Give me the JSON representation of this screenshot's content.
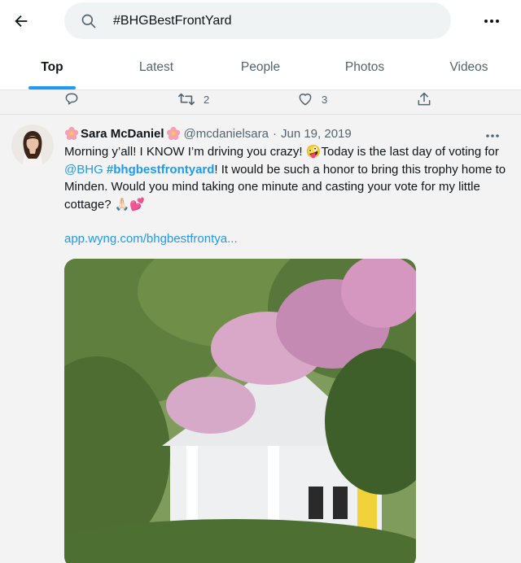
{
  "header": {
    "search_value": "#BHGBestFrontYard"
  },
  "tabs": [
    {
      "label": "Top",
      "active": true
    },
    {
      "label": "Latest",
      "active": false
    },
    {
      "label": "People",
      "active": false
    },
    {
      "label": "Photos",
      "active": false
    },
    {
      "label": "Videos",
      "active": false
    }
  ],
  "previous_tweet": {
    "reply_icon": "reply-icon",
    "retweet_icon": "retweet-icon",
    "retweet_count": "2",
    "like_icon": "heart-icon",
    "like_count": "3",
    "share_icon": "share-icon"
  },
  "tweet": {
    "name": "Sara McDaniel",
    "name_emoji": "flower-emoji",
    "handle": "@mcdanielsara",
    "separator": "·",
    "date": "Jun 19, 2019",
    "text_part1": "Morning y’all! I KNOW I’m driving you crazy! ",
    "emoji_wink": "🤪",
    "text_part2": "Today is the last day of voting for ",
    "mention": "@BHG",
    "text_part3": " ",
    "hashtag": "#bhgbestfrontyard",
    "text_part4": "! It would be such a honor to bring this trophy home to Minden. Would you mind taking one minute and casting your vote for my little cottage? ",
    "emoji_end": "🙏🏻💕",
    "url": "app.wyng.com/bhgbestfrontya..."
  },
  "colors": {
    "accent": "#1d9bf0",
    "text": "#0f1419",
    "muted": "#536471",
    "search_bg": "#eff3f4"
  }
}
